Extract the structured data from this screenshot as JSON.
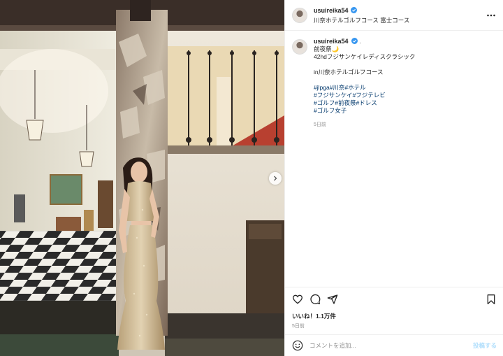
{
  "post": {
    "username": "usuireika54",
    "location": "川奈ホテルゴルフコース 富士コース",
    "caption": {
      "username": "usuireika54",
      "suffix": ".",
      "line1": "前夜祭🌙",
      "line2": "42hdフジサンケイレディスクラシック",
      "line3": "in川奈ホテルゴルフコース",
      "hashtags_line1": [
        "#jlpga",
        "#川奈",
        "#ホテル"
      ],
      "hashtags_line2": [
        "#フジサンケイ",
        "#フジテレビ"
      ],
      "hashtags_line3": [
        "#ゴルフ",
        "#前夜祭",
        "#ドレス"
      ],
      "hashtags_line4": [
        "#ゴルフ女子"
      ],
      "time": "5日前"
    },
    "likes": "いいね！1.1万件",
    "date": "5日前"
  },
  "comment": {
    "placeholder": "コメントを追加...",
    "post_label": "投稿する"
  },
  "icons": {
    "verified": "verified-badge-icon",
    "more": "more-options-icon",
    "like": "heart-icon",
    "comment": "comment-icon",
    "share": "share-icon",
    "save": "bookmark-icon",
    "emoji": "emoji-icon",
    "next": "chevron-right-icon"
  },
  "colors": {
    "verified_blue": "#3897f0",
    "hashtag": "#00376b",
    "muted": "#8e8e8e",
    "post_button": "#b2dffc"
  }
}
